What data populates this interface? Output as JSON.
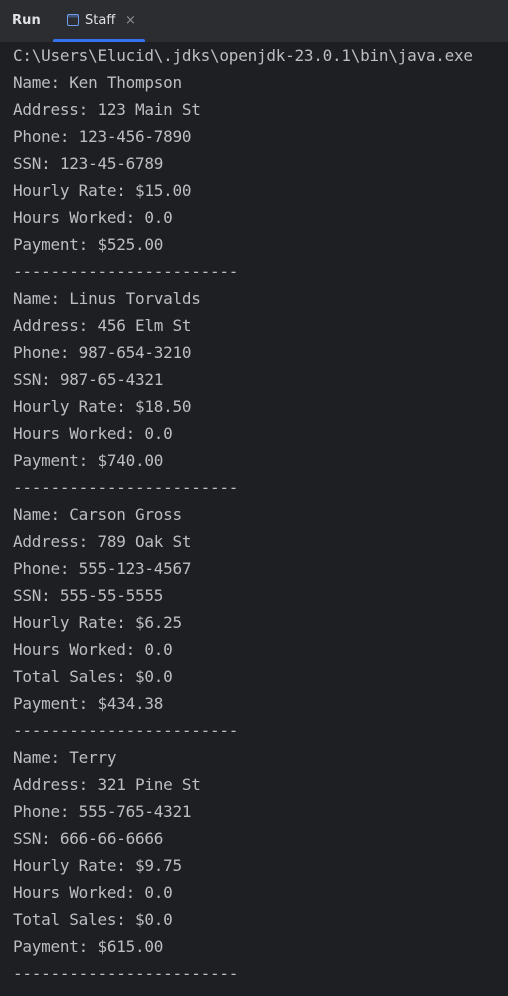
{
  "toolbar": {
    "run_label": "Run",
    "tab_label": "Staff",
    "close_glyph": "×",
    "tab_icon": "console-icon",
    "accent_color": "#3574f0"
  },
  "console": {
    "lines": [
      "C:\\Users\\Elucid\\.jdks\\openjdk-23.0.1\\bin\\java.exe",
      "Name: Ken Thompson",
      "Address: 123 Main St",
      "Phone: 123-456-7890",
      "SSN: 123-45-6789",
      "Hourly Rate: $15.00",
      "Hours Worked: 0.0",
      "Payment: $525.00",
      "------------------------",
      "Name: Linus Torvalds",
      "Address: 456 Elm St",
      "Phone: 987-654-3210",
      "SSN: 987-65-4321",
      "Hourly Rate: $18.50",
      "Hours Worked: 0.0",
      "Payment: $740.00",
      "------------------------",
      "Name: Carson Gross",
      "Address: 789 Oak St",
      "Phone: 555-123-4567",
      "SSN: 555-55-5555",
      "Hourly Rate: $6.25",
      "Hours Worked: 0.0",
      "Total Sales: $0.0",
      "Payment: $434.38",
      "------------------------",
      "Name: Terry",
      "Address: 321 Pine St",
      "Phone: 555-765-4321",
      "SSN: 666-66-6666",
      "Hourly Rate: $9.75",
      "Hours Worked: 0.0",
      "Total Sales: $0.0",
      "Payment: $615.00",
      "------------------------"
    ]
  }
}
